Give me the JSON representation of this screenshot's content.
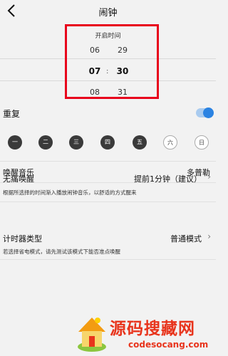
{
  "header": {
    "title": "闹钟",
    "back_icon": "chevron-left-icon"
  },
  "picker": {
    "title": "开启时间",
    "hours": [
      "06",
      "07",
      "08"
    ],
    "minutes": [
      "29",
      "30",
      "31"
    ],
    "separator": ":",
    "selected_hour": "07",
    "selected_minute": "30"
  },
  "repeat": {
    "label": "重复",
    "enabled": true,
    "days": [
      {
        "label": "一",
        "on": true
      },
      {
        "label": "二",
        "on": true
      },
      {
        "label": "三",
        "on": true
      },
      {
        "label": "四",
        "on": true
      },
      {
        "label": "五",
        "on": true
      },
      {
        "label": "六",
        "on": false
      },
      {
        "label": "日",
        "on": false
      }
    ]
  },
  "settings": {
    "music": {
      "label": "唤醒音乐",
      "value": "多普勒"
    },
    "gentle": {
      "label": "无痛唤醒",
      "value": "提前1分钟（建议）",
      "description": "根据所选择的时间渐入播放闹钟音乐，以舒适的方式醒来"
    },
    "timer": {
      "label": "计时器类型",
      "value": "普通模式",
      "description": "若选择省电模式，请先测试该模式下能否准点唤醒"
    }
  },
  "watermark": {
    "text": "源码搜藏网",
    "url": "codesocang.com"
  },
  "colors": {
    "accent": "#2b83e2",
    "highlight": "#e8001c",
    "day_on": "#3a3a3a"
  }
}
